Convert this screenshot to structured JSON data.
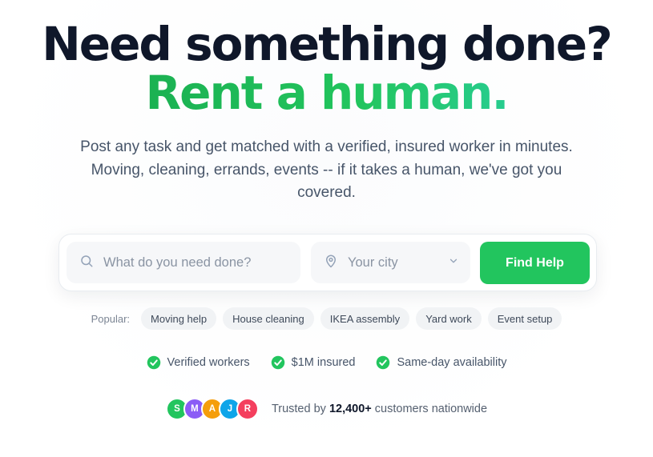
{
  "hero": {
    "headline": "Need something done?",
    "headline_accent": "Rent a human.",
    "subtitle": "Post any task and get matched with a verified, insured worker in minutes. Moving, cleaning, errands, events -- if it takes a human, we've got you covered."
  },
  "search": {
    "task_placeholder": "What do you need done?",
    "task_value": "",
    "city_label": "Your city",
    "button_label": "Find Help"
  },
  "popular": {
    "label": "Popular:",
    "chips": [
      "Moving help",
      "House cleaning",
      "IKEA assembly",
      "Yard work",
      "Event setup"
    ]
  },
  "features": [
    {
      "label": "Verified workers",
      "icon": "check-circle-icon"
    },
    {
      "label": "$1M insured",
      "icon": "check-circle-icon"
    },
    {
      "label": "Same-day availability",
      "icon": "check-circle-icon"
    }
  ],
  "trust": {
    "avatars": [
      {
        "initial": "S",
        "color": "#22c55e"
      },
      {
        "initial": "M",
        "color": "#8b5cf6"
      },
      {
        "initial": "A",
        "color": "#f59e0b"
      },
      {
        "initial": "J",
        "color": "#0ea5e9"
      },
      {
        "initial": "R",
        "color": "#f43f5e"
      }
    ],
    "prefix": "Trusted by",
    "count": "12,400+",
    "suffix": "customers nationwide"
  },
  "colors": {
    "accent": "#22c55e",
    "text_dark": "#0f172a",
    "text_muted": "#475569"
  }
}
